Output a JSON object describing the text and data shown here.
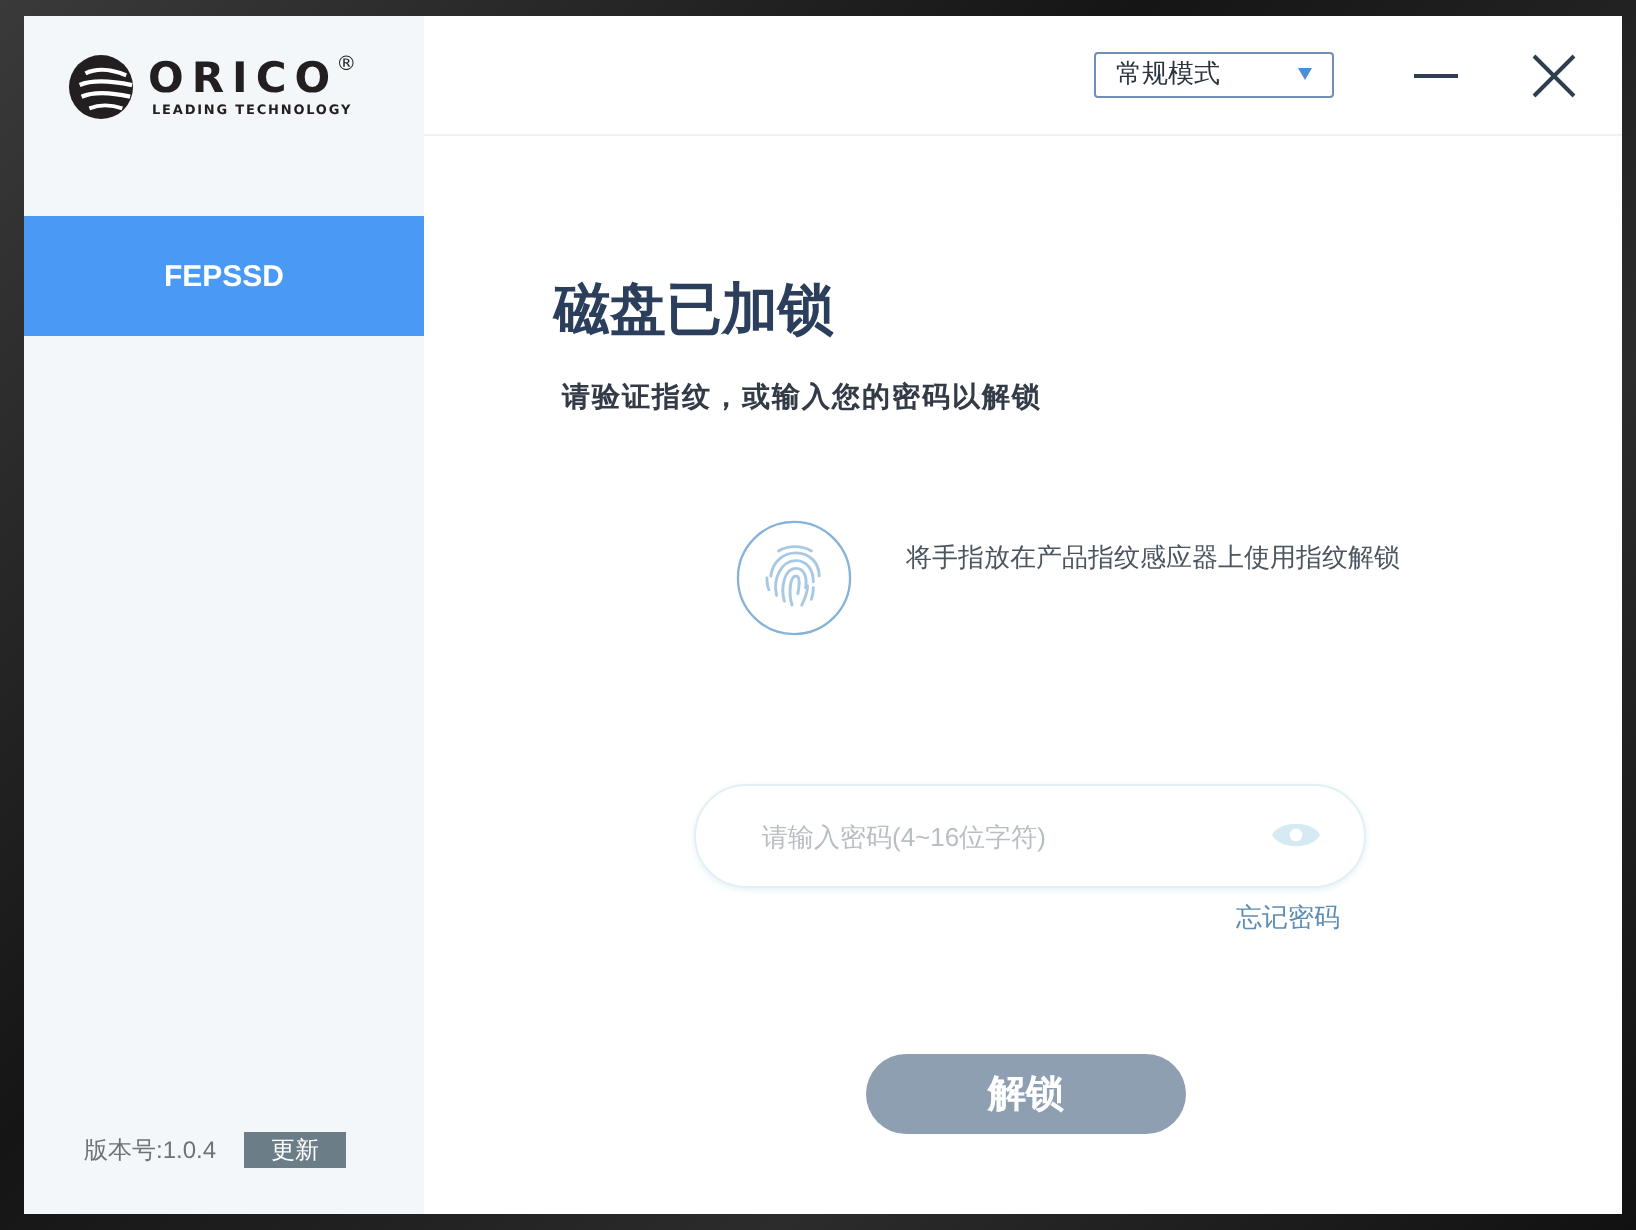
{
  "window": {
    "mode_select": {
      "value": "常规模式"
    }
  },
  "sidebar": {
    "logo": {
      "brand": "ORICO",
      "registered": "®",
      "tagline": "LEADING TECHNOLOGY"
    },
    "items": [
      {
        "label": "FEPSSD",
        "selected": true
      }
    ],
    "version": "版本号:1.0.4",
    "update_button": "更新"
  },
  "main": {
    "title": "磁盘已加锁",
    "subtitle": "请验证指纹，或输入您的密码以解锁",
    "fingerprint_hint": "将手指放在产品指纹感应器上使用指纹解锁",
    "password": {
      "placeholder": "请输入密码(4~16位字符)"
    },
    "forgot_link": "忘记密码",
    "unlock_button": {
      "label": "解锁",
      "disabled": true
    }
  }
}
